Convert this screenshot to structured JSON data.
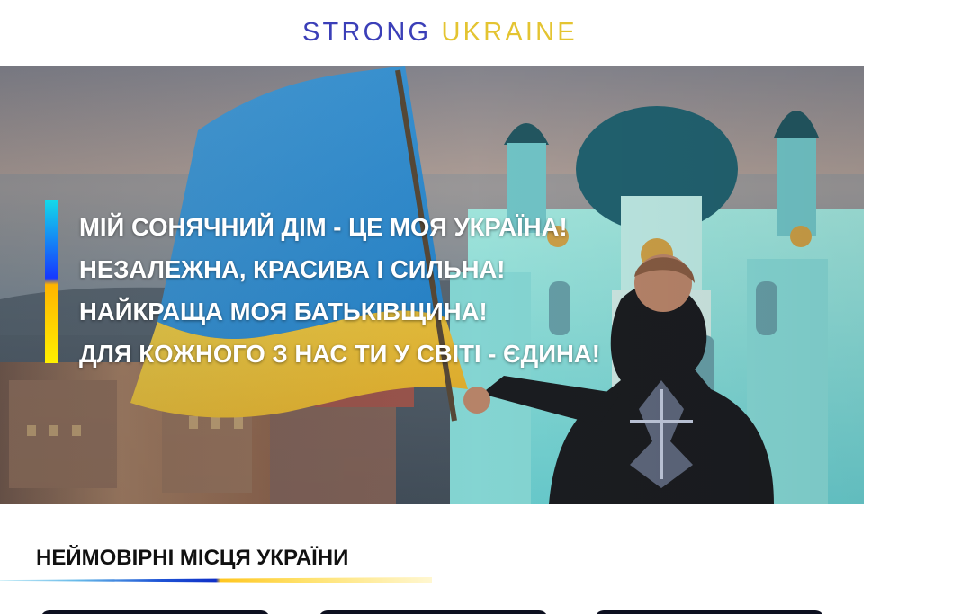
{
  "header": {
    "brand_strong": "STRONG",
    "brand_ukraine": "UKRAINE",
    "brand_colors": {
      "strong": "#3b3fb8",
      "ukraine": "#e4c431"
    }
  },
  "hero": {
    "lines": [
      "МІЙ СОНЯЧНИЙ ДІМ - ЦЕ МОЯ УКРАЇНА!",
      "НЕЗАЛЕЖНА, КРАСИВА І СИЛЬНА!",
      "НАЙКРАЩА МОЯ БАТЬКІВЩИНА!",
      "ДЛЯ КОЖНОГО З НАС ТИ У СВІТІ - ЄДИНА!"
    ],
    "accent_colors": {
      "blue": "#1638ff",
      "yellow": "#fff000",
      "cyan": "#14dbe9"
    }
  },
  "section": {
    "title": "НЕЙМОВІРНІ МІСЦЯ УКРАЇНИ"
  }
}
